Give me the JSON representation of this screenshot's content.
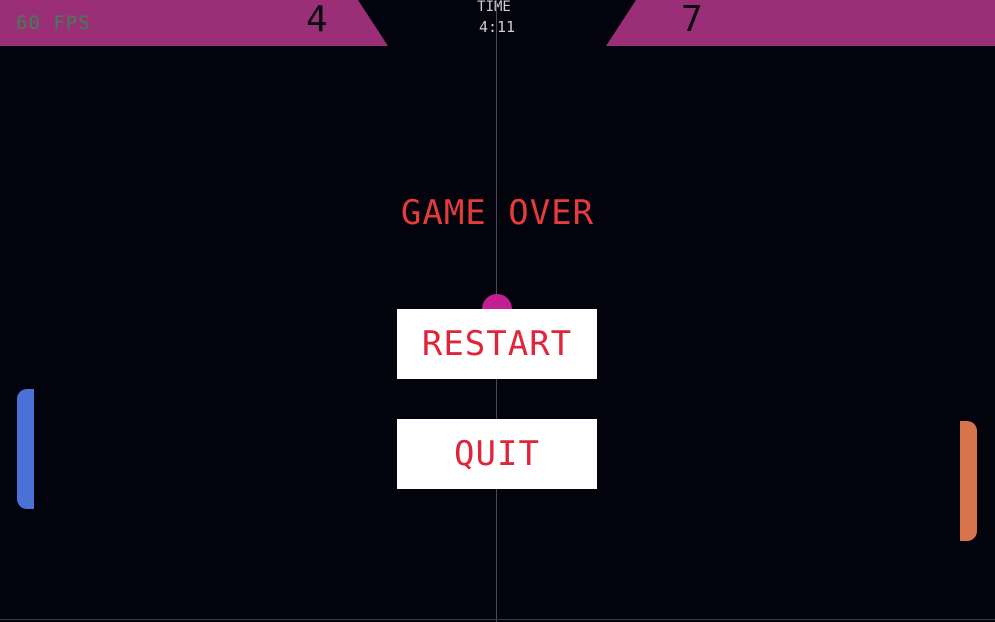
{
  "hud": {
    "fps": "60 FPS",
    "score_left": "4",
    "score_right": "7",
    "time_label": "TIME",
    "time_value": "4:11"
  },
  "menu": {
    "title": "GAME OVER",
    "restart_label": "RESTART",
    "quit_label": "QUIT"
  },
  "colors": {
    "background": "#02030c",
    "banner": "#9a2f78",
    "left_paddle": "#4a72d6",
    "right_paddle": "#d8744c",
    "ball": "#c21f93",
    "title_text": "#e53b3b",
    "button_text": "#e0243a",
    "fps_text": "#3f7f52"
  }
}
